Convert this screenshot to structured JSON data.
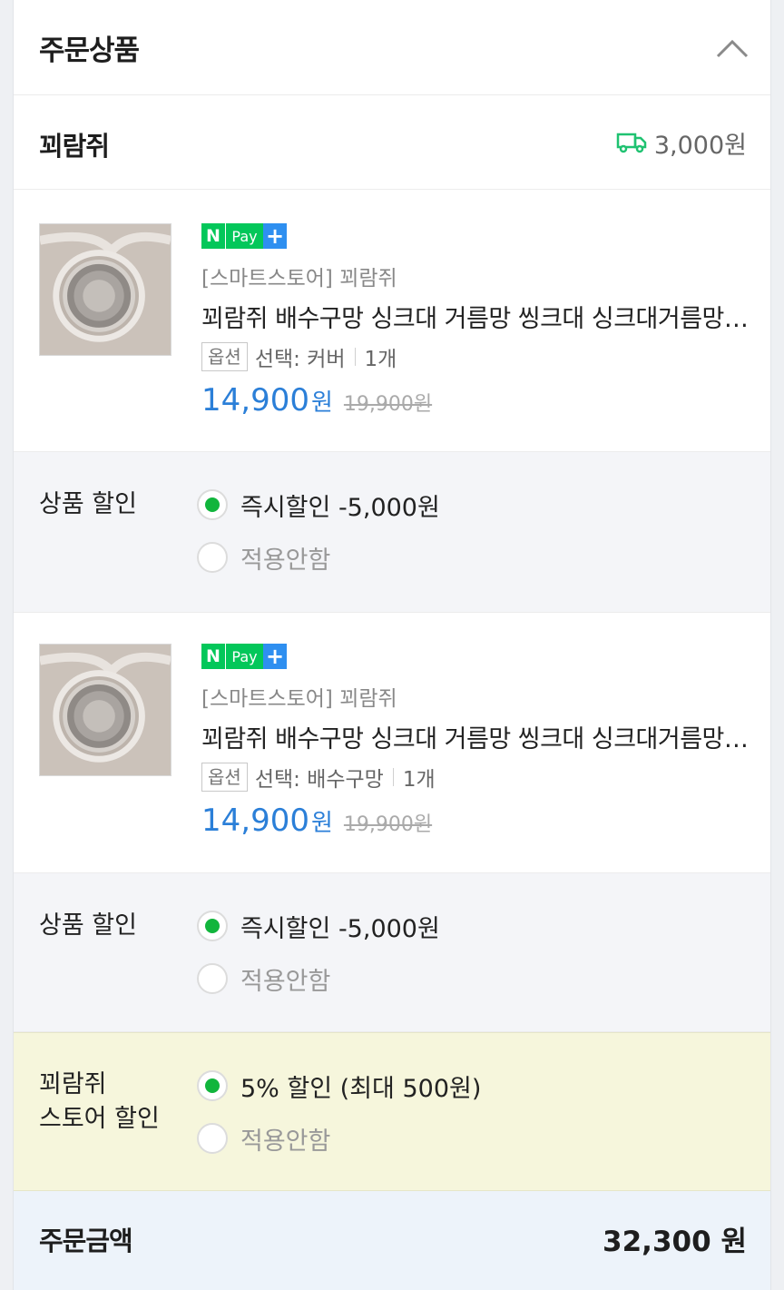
{
  "section": {
    "title": "주문상품"
  },
  "store": {
    "name": "꾀람쥐",
    "shipping_fee": "3,000원",
    "ship_icon": "truck-icon",
    "ship_color": "#1fc271"
  },
  "items": [
    {
      "badge": {
        "n": "N",
        "pay": "Pay",
        "plus": "+"
      },
      "seller": "[스마트스토어] 꾀람쥐",
      "name": "꾀람쥐 배수구망 싱크대 거름망 씽크대 싱크대거름망 배수구커버",
      "option_tag": "옵션",
      "option_value": "선택: 커버",
      "quantity": "1개",
      "price": "14,900",
      "price_unit": "원",
      "original_price": "19,900원",
      "discount": {
        "label": "상품 할인",
        "options": [
          "즉시할인 -5,000원",
          "적용안함"
        ],
        "selected": 0
      }
    },
    {
      "badge": {
        "n": "N",
        "pay": "Pay",
        "plus": "+"
      },
      "seller": "[스마트스토어] 꾀람쥐",
      "name": "꾀람쥐 배수구망 싱크대 거름망 씽크대 싱크대거름망 배수구커버",
      "option_tag": "옵션",
      "option_value": "선택: 배수구망",
      "quantity": "1개",
      "price": "14,900",
      "price_unit": "원",
      "original_price": "19,900원",
      "discount": {
        "label": "상품 할인",
        "options": [
          "즉시할인 -5,000원",
          "적용안함"
        ],
        "selected": 0
      }
    }
  ],
  "store_discount": {
    "label_line1": "꾀람쥐",
    "label_line2": "스토어 할인",
    "options": [
      "5% 할인 (최대 500원)",
      "적용안함"
    ],
    "selected": 0
  },
  "total": {
    "label": "주문금액",
    "amount": "32,300 원"
  },
  "colors": {
    "accent_blue": "#2b7fd8",
    "radio_green": "#11b53c",
    "npay_green": "#03c75a",
    "npay_plus_blue": "#2e8ff0"
  }
}
